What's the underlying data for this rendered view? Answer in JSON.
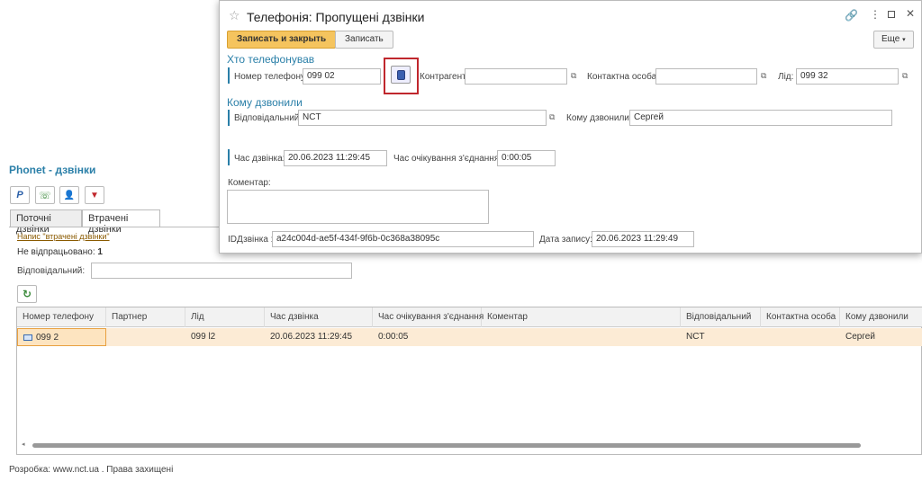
{
  "page": {
    "title": "Phonet - дзвінки",
    "tabs": [
      "Поточні дзвінки",
      "Втрачені дзвінки"
    ],
    "link_text": "Напис \"втрачені дзвінки\"",
    "not_processed_label": "Не відпрацьовано:",
    "not_processed_value": "1",
    "responsible_label": "Відповідальний:",
    "responsible_value": "",
    "footer": "Розробка: www.nct.ua . Права захищені"
  },
  "grid": {
    "columns": [
      "Номер телефону",
      "Партнер",
      "Лід",
      "Час дзвінка",
      "Час очікування з'єднання",
      "Коментар",
      "Відповідальний",
      "Контактна особа",
      "Кому дзвонили"
    ],
    "row": [
      "099            2",
      "",
      "099            l2",
      "20.06.2023 11:29:45",
      "0:00:05",
      "",
      "NCT",
      "",
      "Сергей"
    ]
  },
  "dialog": {
    "title": "Телефонія: Пропущені дзвінки",
    "save_close": "Записать и закрыть",
    "save": "Записать",
    "more": "Еще",
    "who_called": "Хто телефонував",
    "phone_label": "Номер телефону:",
    "phone_value": "099          02",
    "contractor_label": "Контрагент:",
    "contractor_value": "",
    "contact_label": "Контактна особа:",
    "contact_value": "",
    "lead_label": "Лід:",
    "lead_value": "099          32",
    "whom_called": "Кому дзвонили",
    "responsible_label": "Відповідальний:",
    "responsible_value": "NCT",
    "whom_label": "Кому дзвонили:",
    "whom_value": "Сергей",
    "call_time_label": "Час дзвінка:",
    "call_time_value": "20.06.2023 11:29:45",
    "wait_label": "Час очікування з'єднання:",
    "wait_value": "0:00:05",
    "comment_label": "Коментар:",
    "comment_value": "",
    "id_label": "IDДзвінка :",
    "id_value": "a24c004d-ae5f-434f-9f6b-0c368a38095c",
    "record_date_label": "Дата запису:",
    "record_date_value": "20.06.2023 11:29:49"
  },
  "colors": {
    "accent": "#2a7fa8",
    "primary_button": "#f5c45e",
    "selected_row": "#fcebd5",
    "highlight": "#c0272d"
  }
}
